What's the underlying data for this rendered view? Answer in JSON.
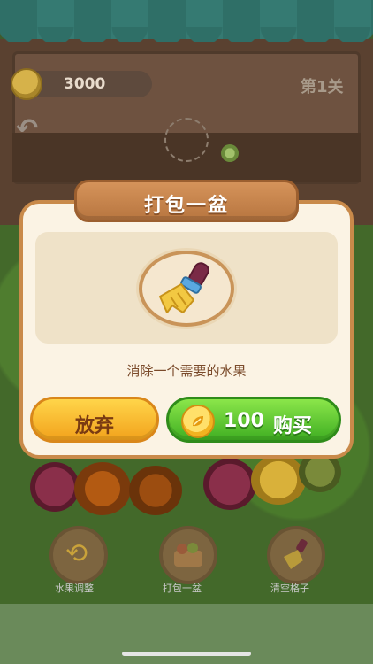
{
  "hud": {
    "coins": "3000",
    "level": "第1关"
  },
  "dialog": {
    "title": "打包一盆",
    "icon": "broom-icon",
    "description": "消除一个需要的水果",
    "abandon_label": "放弃",
    "buy_price": "100",
    "buy_label": "购买"
  },
  "powerups": [
    {
      "label": "水果调整",
      "icon": "shuffle-icon"
    },
    {
      "label": "打包一盆",
      "icon": "basket-icon"
    },
    {
      "label": "清空格子",
      "icon": "broom-icon"
    }
  ],
  "colors": {
    "abandon_button": "#f2a21c",
    "buy_button": "#3fae22",
    "title_plank": "#c98a4a"
  }
}
